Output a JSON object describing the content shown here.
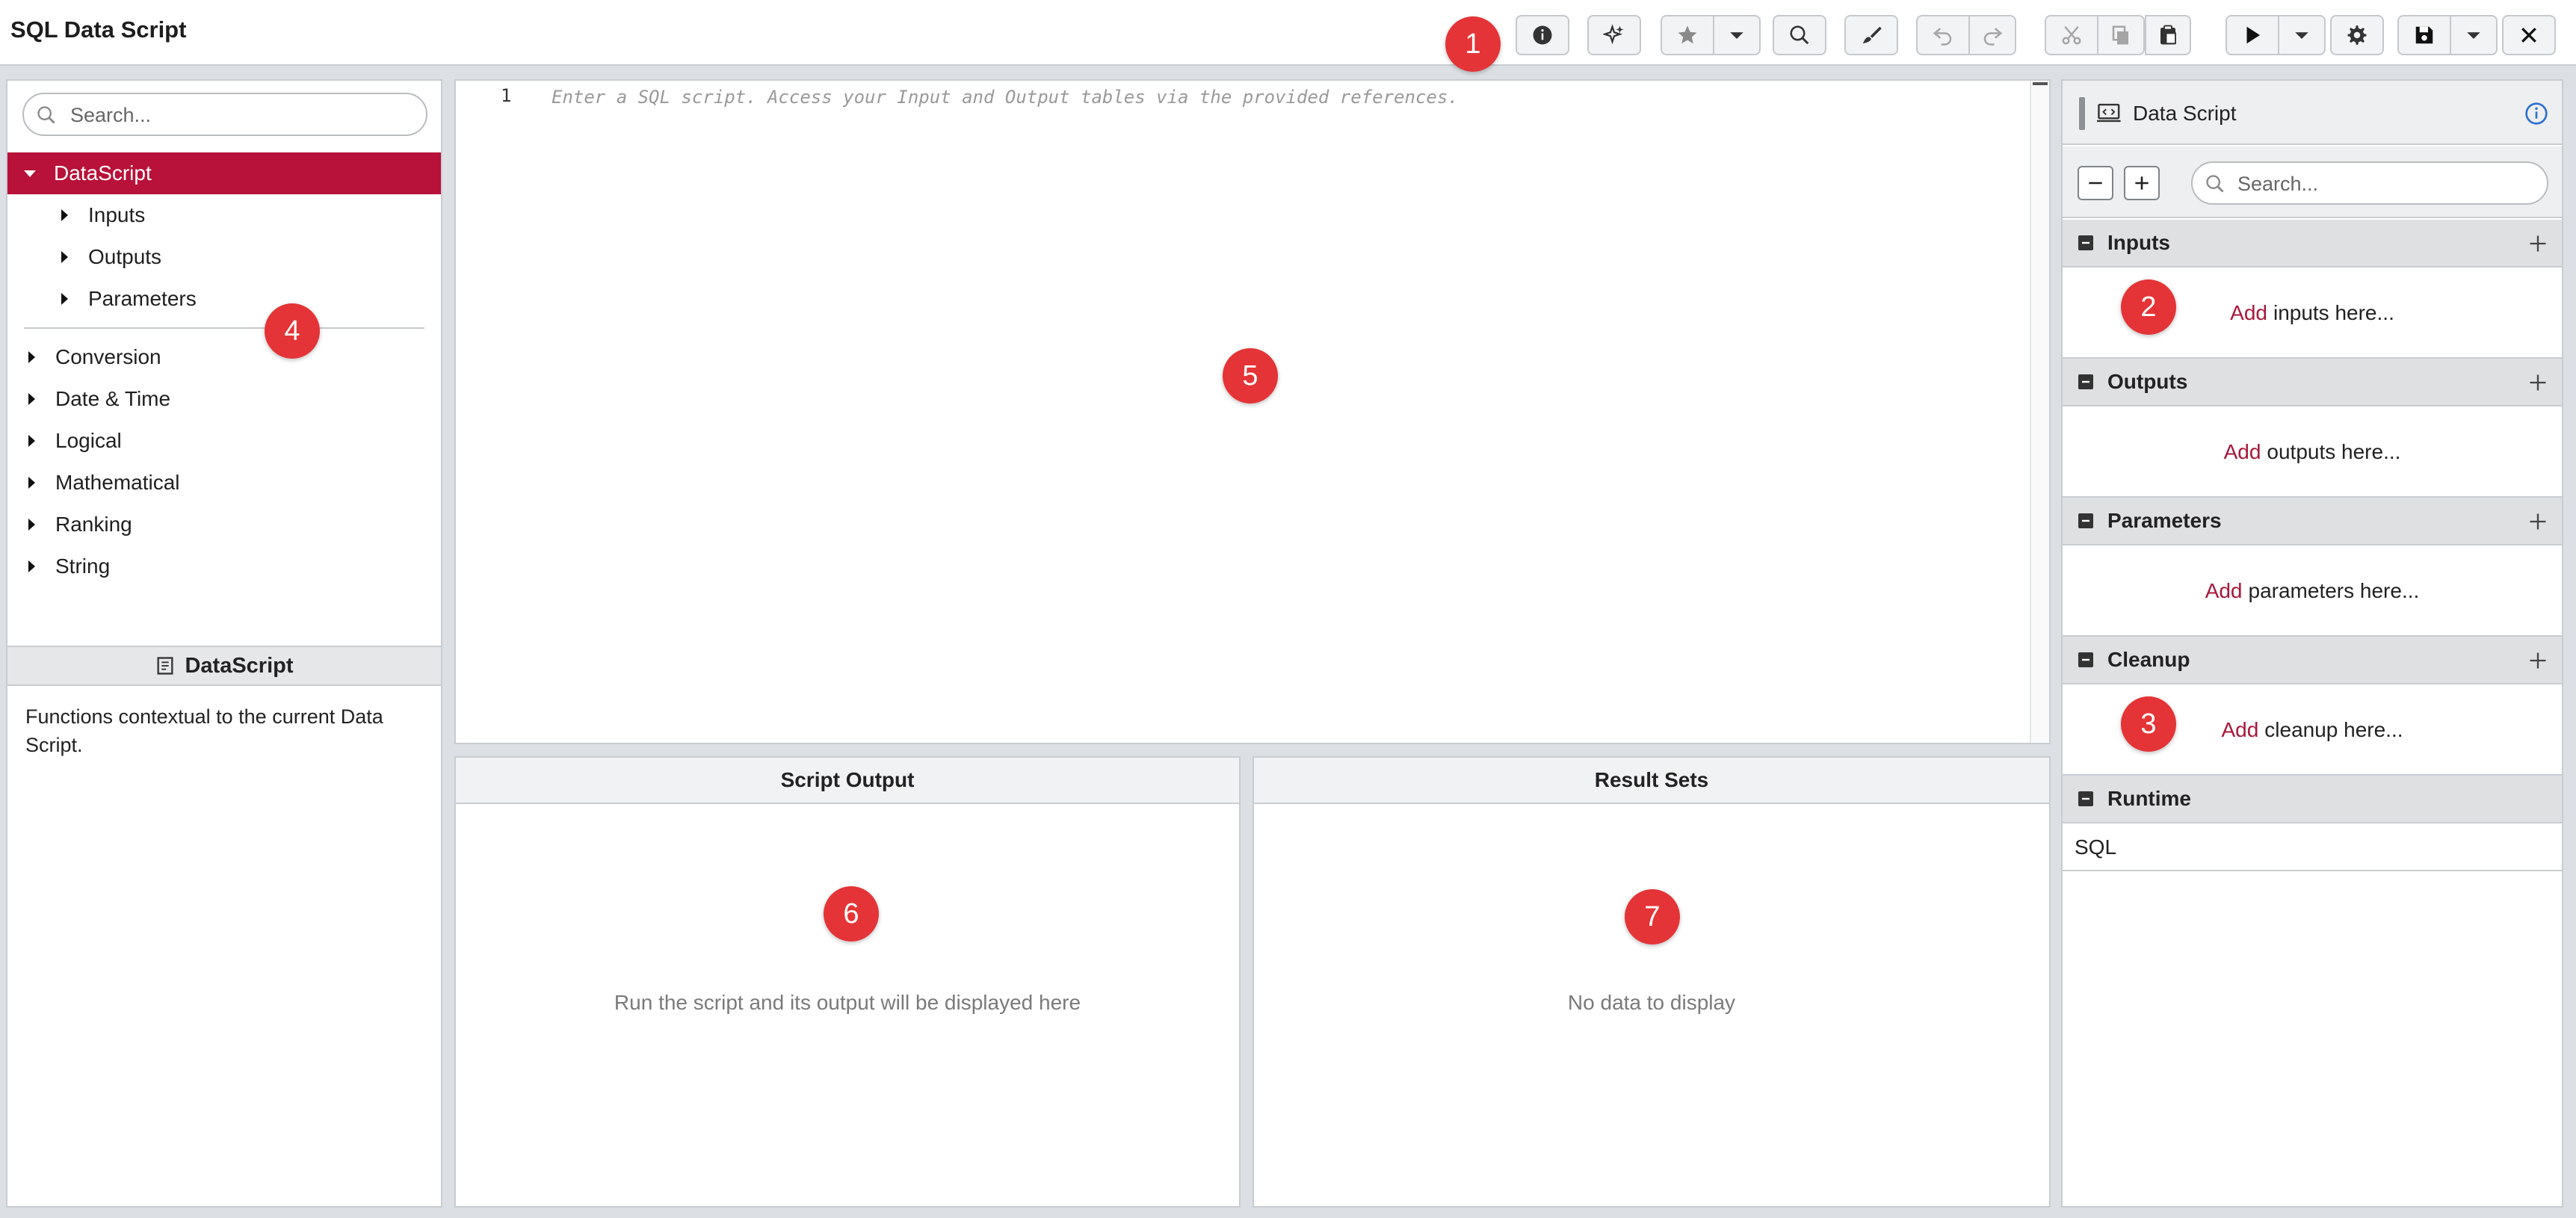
{
  "app": {
    "title": "SQL Data Script"
  },
  "badges": [
    "1",
    "2",
    "3",
    "4",
    "5",
    "6",
    "7"
  ],
  "left": {
    "search_placeholder": "Search...",
    "root": "DataScript",
    "children": [
      "Inputs",
      "Outputs",
      "Parameters"
    ],
    "categories": [
      "Conversion",
      "Date & Time",
      "Logical",
      "Mathematical",
      "Ranking",
      "String"
    ],
    "doc_title": "DataScript",
    "doc_text": "Functions contextual to the current Data Script."
  },
  "editor": {
    "line_number": "1",
    "placeholder": "Enter a SQL script. Access your Input and Output tables via the provided references."
  },
  "script_output": {
    "title": "Script Output",
    "empty": "Run the script and its output will be displayed here"
  },
  "result_sets": {
    "title": "Result Sets",
    "empty": "No data to display"
  },
  "right": {
    "title": "Data Script",
    "search_placeholder": "Search...",
    "add_word": "Add",
    "sections": {
      "inputs": {
        "title": "Inputs",
        "hint": "inputs here..."
      },
      "outputs": {
        "title": "Outputs",
        "hint": "outputs here..."
      },
      "parameters": {
        "title": "Parameters",
        "hint": "parameters here..."
      },
      "cleanup": {
        "title": "Cleanup",
        "hint": "cleanup here..."
      },
      "runtime": {
        "title": "Runtime",
        "value": "SQL"
      }
    }
  },
  "colors": {
    "accent": "#b8113a",
    "badge": "#e43437",
    "add_link": "#a8173a"
  },
  "icons": [
    "info-icon",
    "ai-sparkle-icon",
    "star-icon",
    "chevron-down-icon",
    "search-icon",
    "paint-brush-icon",
    "undo-icon",
    "redo-icon",
    "cut-icon",
    "copy-icon",
    "paste-icon",
    "play-icon",
    "gear-icon",
    "save-icon",
    "close-icon"
  ]
}
